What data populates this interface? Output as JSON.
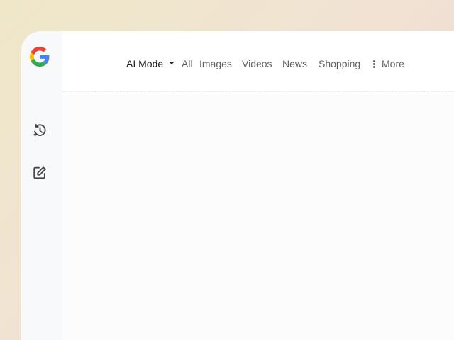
{
  "logo": {
    "icon": "google-g-logo",
    "colors": [
      "#4285F4",
      "#EA4335",
      "#FBBC05",
      "#34A853"
    ]
  },
  "sidebar": {
    "items": [
      {
        "icon": "history-sparkle-icon"
      },
      {
        "icon": "new-chat-edit-icon"
      }
    ]
  },
  "nav": {
    "ai_mode": "AI Mode",
    "all": "All",
    "images": "Images",
    "videos": "Videos",
    "news": "News",
    "shopping": "Shopping",
    "more": "More"
  }
}
